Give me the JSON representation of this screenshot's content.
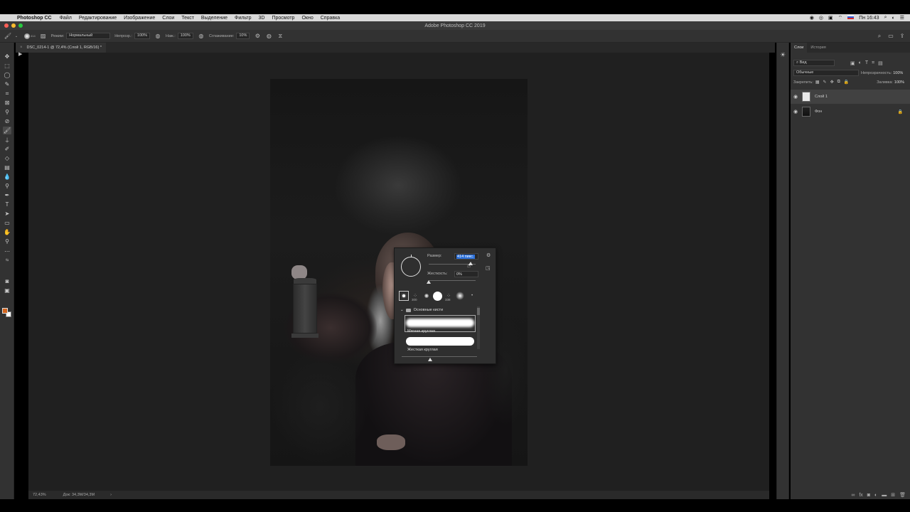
{
  "menubar": {
    "app": "Photoshop CC",
    "items": [
      "Файл",
      "Редактирование",
      "Изображение",
      "Слои",
      "Текст",
      "Выделение",
      "Фильтр",
      "3D",
      "Просмотр",
      "Окно",
      "Справка"
    ],
    "clock": "Пн 16:43"
  },
  "window": {
    "title": "Adobe Photoshop CC 2019"
  },
  "options": {
    "brush_size": "414",
    "mode_label": "Режим:",
    "mode_value": "Нормальный",
    "opacity_label": "Непрозр.:",
    "opacity_value": "100%",
    "pressure_label": "Наж.:",
    "pressure_value": "100%",
    "smoothing_label": "Сглаживание:",
    "smoothing_value": "10%"
  },
  "document": {
    "tab_title": "DSC_0214-1 @ 72,4% (Слой 1, RGB/16) *"
  },
  "status": {
    "zoom": "72,43%",
    "doc_info": "Док: 34,3M/34,3M"
  },
  "brush_popup": {
    "size_label": "Размер:",
    "size_value": "414 пикс.",
    "size_fraction": 0.9,
    "hardness_label": "Жесткость:",
    "hardness_value": "0%",
    "hardness_fraction": 0.0,
    "tip_numbers": [
      "300",
      "338"
    ],
    "group_name": "Основные кисти",
    "brushes": [
      "Мягкая круглая",
      "Жесткая круглая"
    ]
  },
  "layers_panel": {
    "tabs": [
      "Слои",
      "История"
    ],
    "filter": "Вид",
    "blend_mode": "Обычные",
    "opacity_label": "Непрозрачность:",
    "opacity_value": "100%",
    "lock_label": "Закрепить:",
    "fill_label": "Заливка:",
    "fill_value": "100%",
    "layers": [
      {
        "name": "Слой 1",
        "selected": true
      },
      {
        "name": "Фон",
        "selected": false
      }
    ]
  },
  "colors": {
    "foreground": "#d4661f",
    "background": "#ffffff"
  }
}
